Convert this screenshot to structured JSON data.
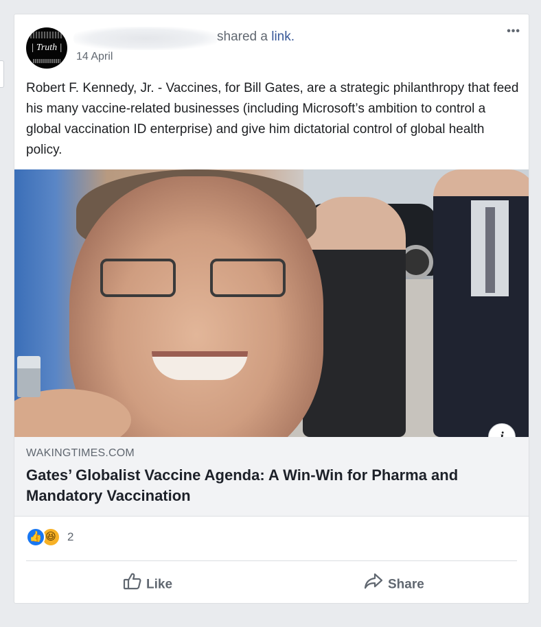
{
  "post": {
    "avatar_text": "| Truth |",
    "shared_text": "shared a",
    "shared_link": "link.",
    "date": "14 April",
    "more_icon": "more-options-icon",
    "text": "Robert F. Kennedy, Jr. - Vaccines, for Bill Gates, are a strategic philanthropy that feed his many vaccine-related businesses (including Microsoft’s ambition to control a global vaccination ID enterprise) and give him dictatorial control of global health policy."
  },
  "link_preview": {
    "domain": "WAKINGTIMES.COM",
    "title": "Gates’ Globalist Vaccine Agenda: A Win-Win for Pharma and Mandatory Vaccination",
    "info_label": "i"
  },
  "reactions": {
    "count": "2",
    "icons": [
      "like-reaction-icon",
      "haha-reaction-icon"
    ]
  },
  "actions": {
    "like_label": "Like",
    "share_label": "Share"
  },
  "colors": {
    "link": "#385898",
    "like_blue": "#1877f2",
    "haha_yellow": "#f7b125"
  }
}
